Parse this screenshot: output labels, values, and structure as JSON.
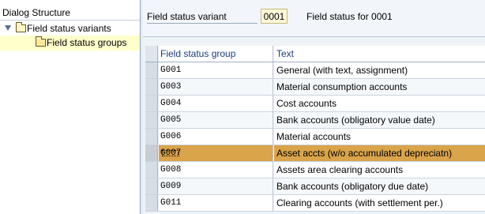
{
  "tree": {
    "title": "Dialog Structure",
    "nodes": [
      {
        "label": "Field status variants"
      },
      {
        "label": "Field status groups"
      }
    ]
  },
  "header": {
    "field_status_variant_label": "Field status variant",
    "field_status_variant_value": "0001",
    "field_status_variant_desc": "Field status for 0001"
  },
  "table": {
    "columns": [
      "Field status group",
      "Text"
    ],
    "rows": [
      {
        "group": "G001",
        "text": "General (with text, assignment)"
      },
      {
        "group": "G003",
        "text": "Material consumption accounts"
      },
      {
        "group": "G004",
        "text": "Cost accounts"
      },
      {
        "group": "G005",
        "text": "Bank accounts (obligatory value date)"
      },
      {
        "group": "G006",
        "text": "Material accounts"
      },
      {
        "group": "G007",
        "text": "Asset accts (w/o accumulated depreciatn)"
      },
      {
        "group": "G008",
        "text": "Assets area clearing accounts"
      },
      {
        "group": "G009",
        "text": "Bank accounts (obligatory due date)"
      },
      {
        "group": "G011",
        "text": "Clearing accounts (with settlement per.)"
      }
    ]
  }
}
